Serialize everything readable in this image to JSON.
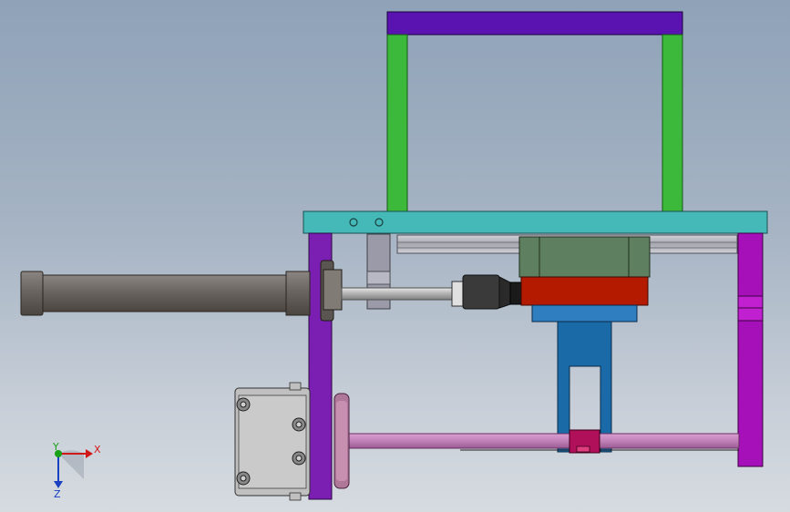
{
  "viewport": {
    "background_top": "#8fa2b8",
    "background_bottom": "#d6dbe0"
  },
  "colors": {
    "top_beam": "#5a12b0",
    "uprights": "#3cb83a",
    "plate": "#45b8b8",
    "frame_left": "#7a1fb2",
    "frame_right": "#a510b8",
    "cylinder": "#6a6560",
    "block_green": "#5f8060",
    "block_red": "#b31a00",
    "blue_part": "#1a6aa8",
    "pink_rod": "#c080b8",
    "pink_wheel": "#b07898",
    "magenta_clip": "#b0105a",
    "motor": "#c0c0c0",
    "guide_gray": "#9a9aa8"
  },
  "triad": {
    "x_label": "X",
    "y_label": "Y",
    "z_label": "Z",
    "x_color": "#d01818",
    "y_color": "#18a018",
    "z_color": "#1840c0"
  }
}
